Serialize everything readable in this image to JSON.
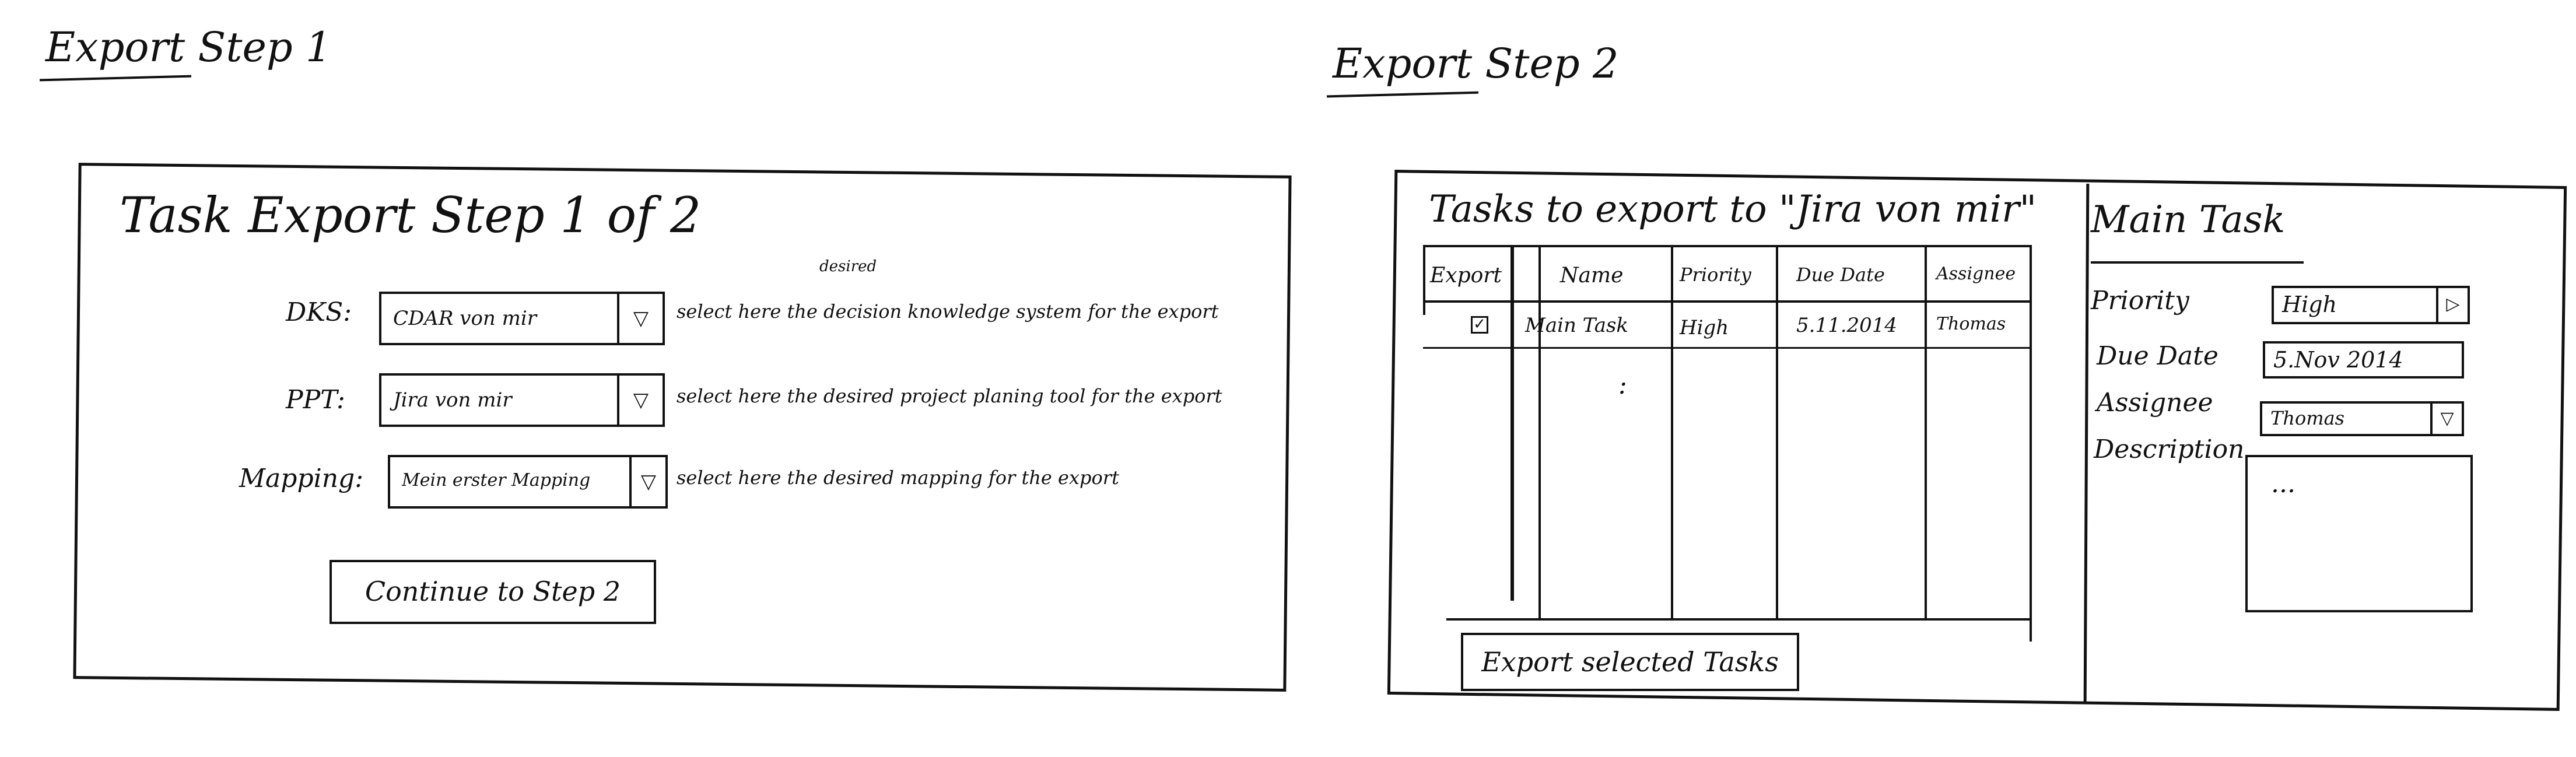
{
  "step1": {
    "heading": "Export Step 1",
    "dialog_title": "Task Export Step 1 of 2",
    "rows": [
      {
        "label": "DKS:",
        "value": "CDAR von mir",
        "arrow": "▽",
        "hint": "select here the decision knowledge system for the export",
        "note": "desired"
      },
      {
        "label": "PPT:",
        "value": "Jira von mir",
        "arrow": "▽",
        "hint": "select here the desired project planing tool for the export"
      },
      {
        "label": "Mapping:",
        "value": "Mein erster Mapping",
        "arrow": "▽",
        "hint": "select here the desired mapping for the export"
      }
    ],
    "continue_button": "Continue to Step 2"
  },
  "step2": {
    "heading": "Export Step 2",
    "table_title": "Tasks to export to \"Jira von mir\"",
    "columns": [
      "Export",
      "Name",
      "Priority",
      "Due Date",
      "Assignee"
    ],
    "rows": [
      {
        "export_checked": true,
        "check_mark": "✓",
        "name": "Main Task",
        "priority": "High",
        "due_date": "5.11.2014",
        "assignee": "Thomas"
      }
    ],
    "ellipsis": ":",
    "export_button": "Export selected Tasks",
    "detail": {
      "title": "Main Task",
      "priority_label": "Priority",
      "priority_value": "High",
      "due_date_label": "Due Date",
      "due_date_value": "5.Nov 2014",
      "assignee_label": "Assignee",
      "assignee_value": "Thomas",
      "description_label": "Description",
      "description_value": "...",
      "arrow": "▷",
      "arrow_down": "▽"
    }
  }
}
